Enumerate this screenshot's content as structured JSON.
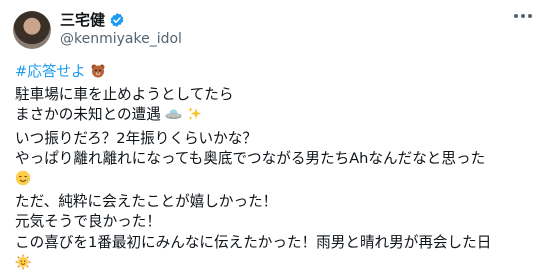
{
  "user": {
    "display_name": "三宅健",
    "handle": "@kenmiyake_idol"
  },
  "post": {
    "hashtag": "#応答せよ",
    "lines": [
      "駐車場に車を止めようとしてたら",
      "まさかの未知との遭遇",
      "いつ振りだろ？2年振りくらいかな？",
      "やっぱり離れ離れになっても奥底でつながる男たちAhなんだなと思った",
      "ただ、純粋に会えたことが嬉しかった！",
      "元気そうで良かった！",
      "この喜びを1番最初にみんなに伝えたかった！雨男と晴れ男が再会した日"
    ]
  },
  "icons": {
    "verified": "verified-badge-icon",
    "more": "more-options-icon",
    "bear": "teddy-bear-emoji",
    "ufo": "flying-saucer-emoji",
    "sparkles": "sparkles-emoji",
    "smile_tear": "smiling-face-with-tear-emoji",
    "sun": "sun-with-face-emoji"
  },
  "colors": {
    "link": "#1d9bf0",
    "verified": "#1d9bf0",
    "secondary_text": "#536471"
  }
}
